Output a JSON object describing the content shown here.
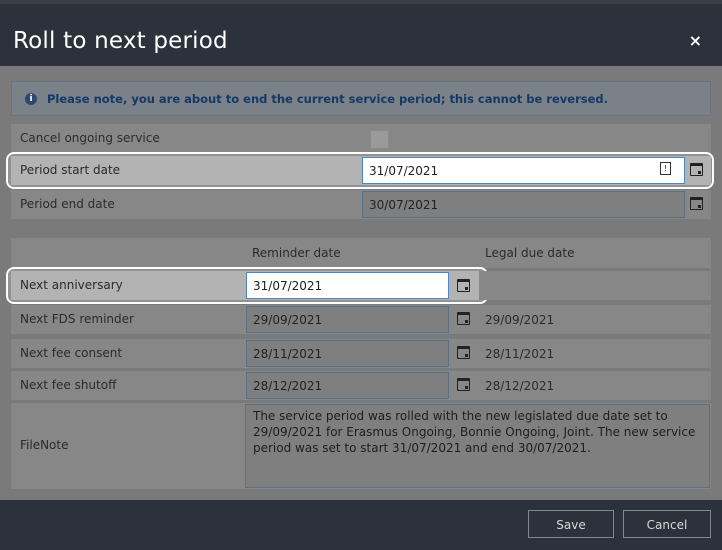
{
  "dialog": {
    "title": "Roll to next period",
    "close_label": "×"
  },
  "notice": {
    "text": "Please note, you are about to end the current service period; this cannot be reversed."
  },
  "rows": {
    "cancel_ongoing": {
      "label": "Cancel ongoing service",
      "checked": false
    },
    "period_start": {
      "label": "Period start date",
      "value": "31/07/2021"
    },
    "period_end": {
      "label": "Period end date",
      "value": "30/07/2021"
    }
  },
  "table": {
    "col_reminder": "Reminder date",
    "col_legal": "Legal due date",
    "next_anniversary": {
      "label": "Next anniversary",
      "reminder": "31/07/2021",
      "legal": ""
    },
    "next_fds": {
      "label": "Next FDS reminder",
      "reminder": "29/09/2021",
      "legal": "29/09/2021"
    },
    "next_fee_consent": {
      "label": "Next fee consent",
      "reminder": "28/11/2021",
      "legal": "28/11/2021"
    },
    "next_fee_shutoff": {
      "label": "Next fee shutoff",
      "reminder": "28/12/2021",
      "legal": "28/12/2021"
    }
  },
  "filenote": {
    "label": "FileNote",
    "text": "The service period was rolled with the new legislated due date set to 29/09/2021 for Erasmus Ongoing, Bonnie Ongoing, Joint. The new service period was set to start 31/07/2021 and end 30/07/2021."
  },
  "footer": {
    "save_label": "Save",
    "cancel_label": "Cancel"
  },
  "colors": {
    "titlebar": "#2b323b",
    "highlight": "#ffffff",
    "notice_text": "#163866"
  },
  "icons": [
    "info-icon",
    "calendar-icon",
    "close-icon"
  ]
}
